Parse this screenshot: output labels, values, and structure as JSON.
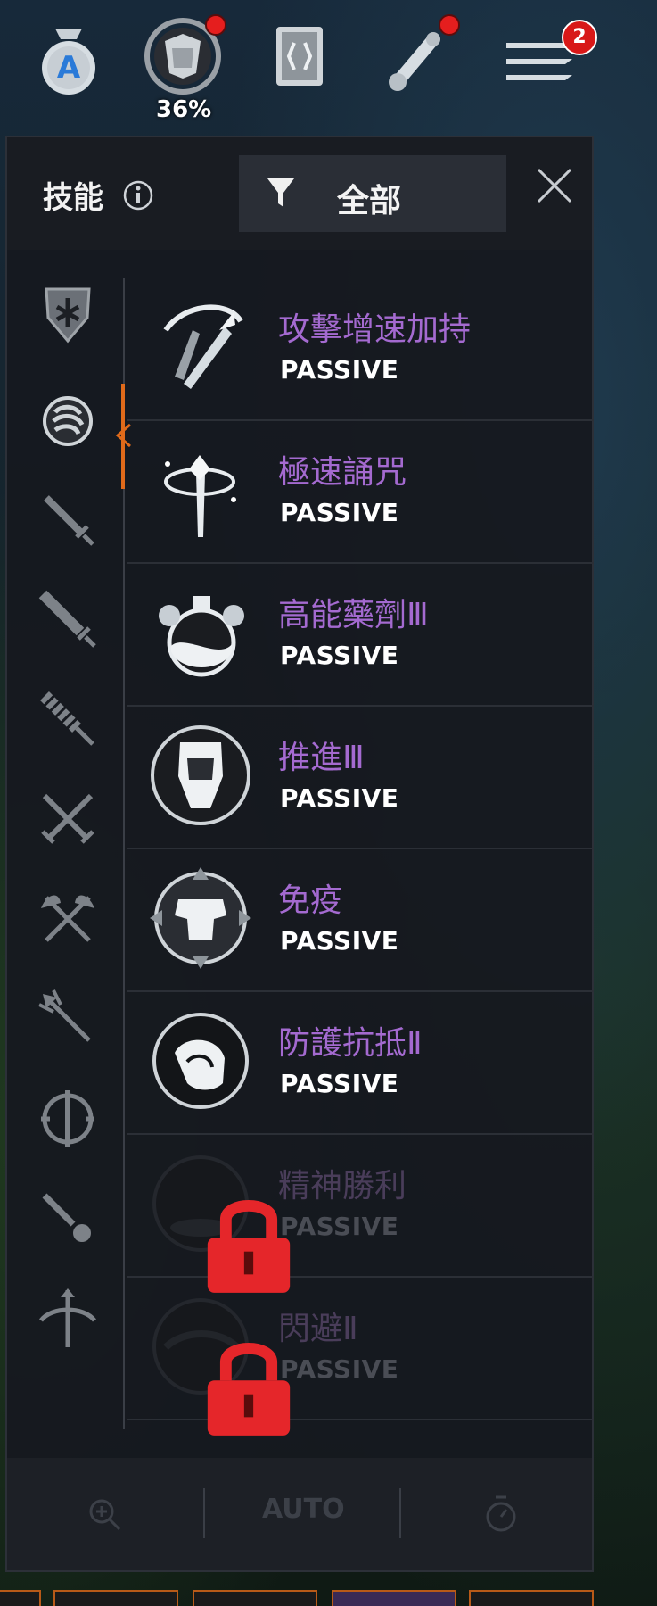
{
  "hud": {
    "bag_label": "A",
    "armor_percent": "36%",
    "menu_badge": "2"
  },
  "panel": {
    "title": "技能",
    "filter_label": "全部"
  },
  "sidebar": {
    "items": [
      {
        "icon": "shield-cross-icon"
      },
      {
        "icon": "hand-fist-icon",
        "active": true
      },
      {
        "icon": "sword-icon"
      },
      {
        "icon": "greatsword-icon"
      },
      {
        "icon": "spiked-club-icon"
      },
      {
        "icon": "crossed-swords-icon"
      },
      {
        "icon": "crossed-axes-icon"
      },
      {
        "icon": "trident-icon"
      },
      {
        "icon": "wheel-blade-icon"
      },
      {
        "icon": "dagger-icon"
      },
      {
        "icon": "crossbow-icon"
      }
    ]
  },
  "skills": [
    {
      "name": "攻擊增速加持",
      "type": "PASSIVE",
      "locked": false,
      "icon": "haste-blades-icon"
    },
    {
      "name": "極速誦咒",
      "type": "PASSIVE",
      "locked": false,
      "icon": "spell-staff-icon"
    },
    {
      "name": "高能藥劑Ⅲ",
      "type": "PASSIVE",
      "locked": false,
      "icon": "potion-icon"
    },
    {
      "name": "推進Ⅲ",
      "type": "PASSIVE",
      "locked": false,
      "icon": "fist-emblem-icon"
    },
    {
      "name": "免疫",
      "type": "PASSIVE",
      "locked": false,
      "icon": "armor-compass-icon"
    },
    {
      "name": "防護抗抵Ⅱ",
      "type": "PASSIVE",
      "locked": false,
      "icon": "guard-hand-icon"
    },
    {
      "name": "精神勝利",
      "type": "PASSIVE",
      "locked": true,
      "icon": "spirit-icon"
    },
    {
      "name": "閃避Ⅱ",
      "type": "PASSIVE",
      "locked": true,
      "icon": "dodge-icon"
    }
  ],
  "bottom": {
    "auto_label": "AUTO"
  },
  "colors": {
    "skill_name": "#a46ad0",
    "accent_orange": "#e06a1a",
    "lock_red": "#e5262a",
    "badge_red": "#d81818"
  }
}
